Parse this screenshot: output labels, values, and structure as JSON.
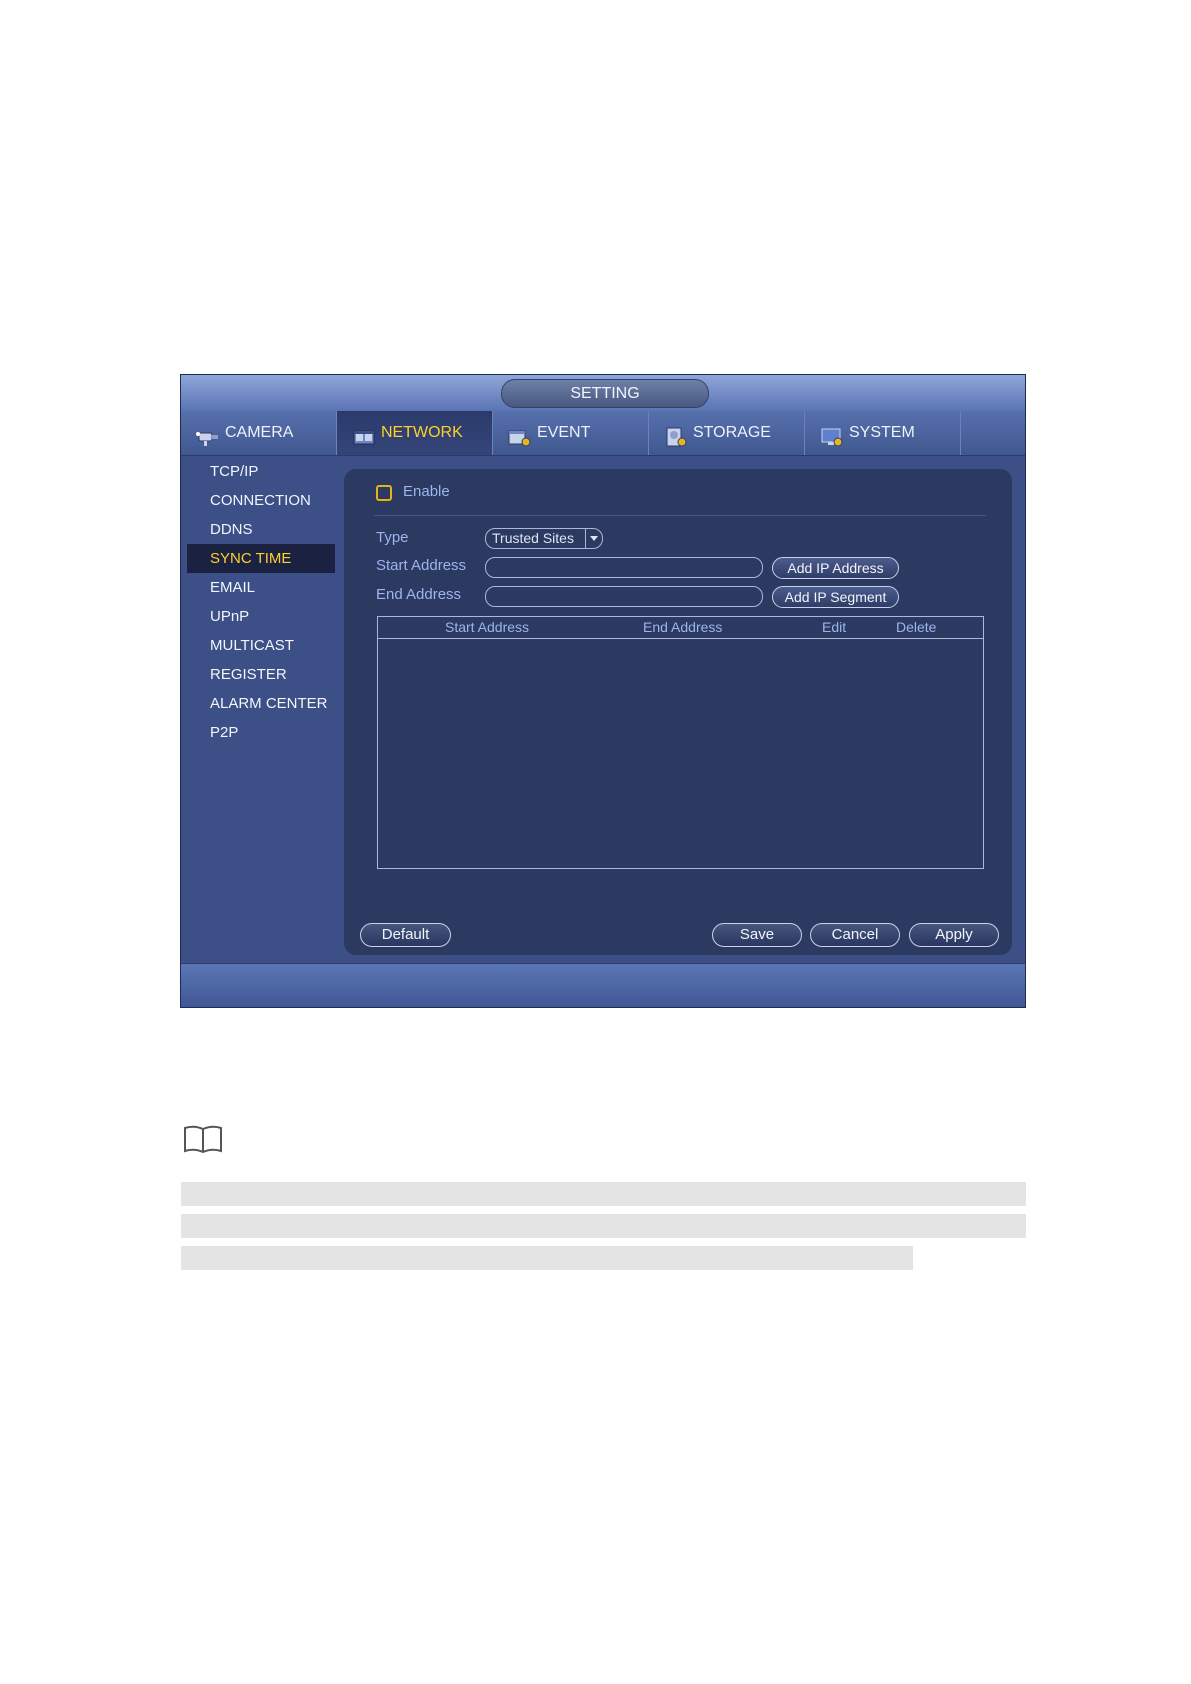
{
  "window": {
    "title": "SETTING"
  },
  "tabs": [
    {
      "label": "CAMERA",
      "icon": "camera-icon",
      "active": false
    },
    {
      "label": "NETWORK",
      "icon": "network-icon",
      "active": true
    },
    {
      "label": "EVENT",
      "icon": "event-icon",
      "active": false
    },
    {
      "label": "STORAGE",
      "icon": "storage-icon",
      "active": false
    },
    {
      "label": "SYSTEM",
      "icon": "system-icon",
      "active": false
    }
  ],
  "sidebar": {
    "items": [
      {
        "label": "TCP/IP"
      },
      {
        "label": "CONNECTION"
      },
      {
        "label": "DDNS"
      },
      {
        "label": "SYNC TIME",
        "active": true
      },
      {
        "label": "EMAIL"
      },
      {
        "label": "UPnP"
      },
      {
        "label": "MULTICAST"
      },
      {
        "label": "REGISTER"
      },
      {
        "label": "ALARM CENTER"
      },
      {
        "label": "P2P"
      }
    ]
  },
  "form": {
    "enable_label": "Enable",
    "enable_checked": false,
    "type_label": "Type",
    "type_value": "Trusted Sites",
    "start_label": "Start Address",
    "start_value": "",
    "end_label": "End Address",
    "end_value": "",
    "add_ip_address": "Add IP Address",
    "add_ip_segment": "Add IP Segment"
  },
  "table": {
    "columns": [
      "Start Address",
      "End Address",
      "Edit",
      "Delete"
    ],
    "rows": []
  },
  "buttons": {
    "default": "Default",
    "save": "Save",
    "cancel": "Cancel",
    "apply": "Apply"
  },
  "colors": {
    "panel_bg": "#3c4f86",
    "accent_active": "#ffd02a",
    "label_blue": "#9cb4f0"
  }
}
